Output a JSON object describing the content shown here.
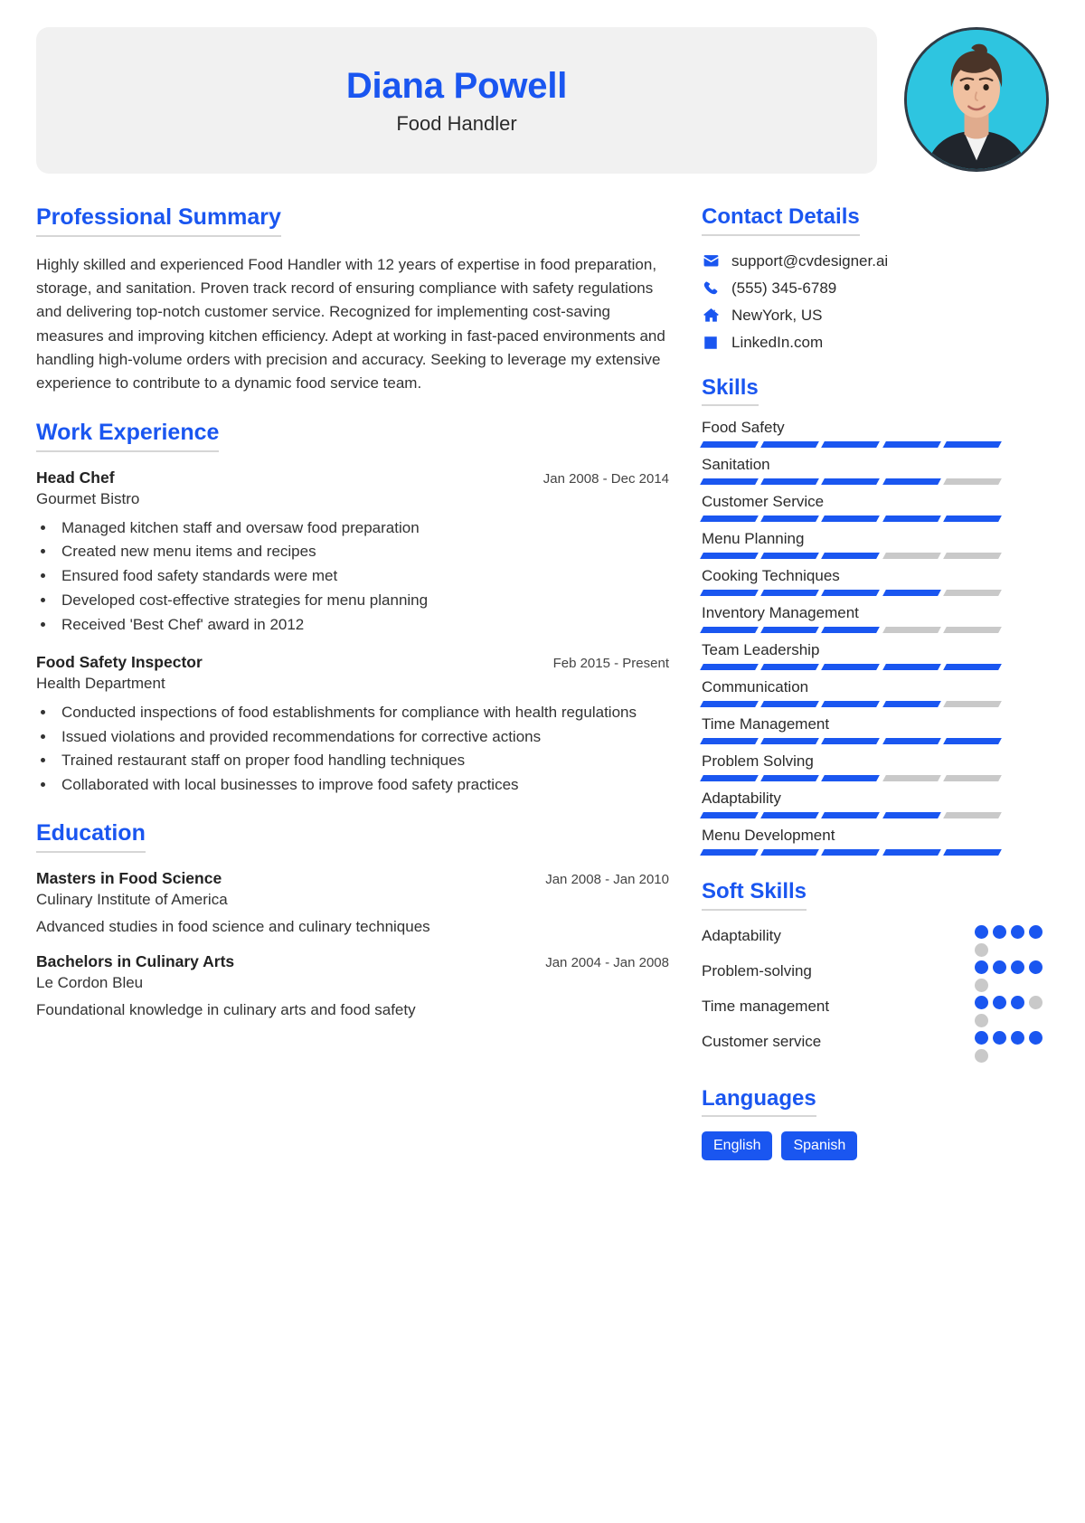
{
  "header": {
    "name": "Diana Powell",
    "job_title": "Food Handler",
    "avatar_alt": "profile-photo"
  },
  "summary": {
    "heading": "Professional Summary",
    "text": "Highly skilled and experienced Food Handler with 12 years of expertise in food preparation, storage, and sanitation. Proven track record of ensuring compliance with safety regulations and delivering top-notch customer service. Recognized for implementing cost-saving measures and improving kitchen efficiency. Adept at working in fast-paced environments and handling high-volume orders with precision and accuracy. Seeking to leverage my extensive experience to contribute to a dynamic food service team."
  },
  "experience": {
    "heading": "Work Experience",
    "items": [
      {
        "title": "Head Chef",
        "date": "Jan 2008 - Dec 2014",
        "org": "Gourmet Bistro",
        "bullets": [
          "Managed kitchen staff and oversaw food preparation",
          "Created new menu items and recipes",
          "Ensured food safety standards were met",
          "Developed cost-effective strategies for menu planning",
          "Received 'Best Chef' award in 2012"
        ]
      },
      {
        "title": "Food Safety Inspector",
        "date": "Feb 2015 - Present",
        "org": "Health Department",
        "bullets": [
          "Conducted inspections of food establishments for compliance with health regulations",
          "Issued violations and provided recommendations for corrective actions",
          "Trained restaurant staff on proper food handling techniques",
          "Collaborated with local businesses to improve food safety practices"
        ]
      }
    ]
  },
  "education": {
    "heading": "Education",
    "items": [
      {
        "title": "Masters in Food Science",
        "date": "Jan 2008 - Jan 2010",
        "org": "Culinary Institute of America",
        "desc": "Advanced studies in food science and culinary techniques"
      },
      {
        "title": "Bachelors in Culinary Arts",
        "date": "Jan 2004 - Jan 2008",
        "org": "Le Cordon Bleu",
        "desc": "Foundational knowledge in culinary arts and food safety"
      }
    ]
  },
  "contact": {
    "heading": "Contact Details",
    "items": [
      {
        "icon": "envelope-icon",
        "value": "support@cvdesigner.ai"
      },
      {
        "icon": "phone-icon",
        "value": "(555) 345-6789"
      },
      {
        "icon": "home-icon",
        "value": "NewYork, US"
      },
      {
        "icon": "linkedin-icon",
        "value": "LinkedIn.com"
      }
    ]
  },
  "skills": {
    "heading": "Skills",
    "max_level": 5,
    "items": [
      {
        "name": "Food Safety",
        "level": 5
      },
      {
        "name": "Sanitation",
        "level": 4
      },
      {
        "name": "Customer Service",
        "level": 5
      },
      {
        "name": "Menu Planning",
        "level": 3
      },
      {
        "name": "Cooking Techniques",
        "level": 4
      },
      {
        "name": "Inventory Management",
        "level": 3
      },
      {
        "name": "Team Leadership",
        "level": 5
      },
      {
        "name": "Communication",
        "level": 4
      },
      {
        "name": "Time Management",
        "level": 5
      },
      {
        "name": "Problem Solving",
        "level": 3
      },
      {
        "name": "Adaptability",
        "level": 4
      },
      {
        "name": "Menu Development",
        "level": 5
      }
    ]
  },
  "soft_skills": {
    "heading": "Soft Skills",
    "max_level": 5,
    "items": [
      {
        "name": "Adaptability",
        "level": 4
      },
      {
        "name": "Problem-solving",
        "level": 4
      },
      {
        "name": "Time management",
        "level": 3
      },
      {
        "name": "Customer service",
        "level": 4
      }
    ]
  },
  "languages": {
    "heading": "Languages",
    "items": [
      "English",
      "Spanish"
    ]
  },
  "colors": {
    "accent": "#1a56f0",
    "muted_bar": "#c9c9c9",
    "header_bg": "#f1f1f1",
    "avatar_bg": "#2ec5e0"
  }
}
